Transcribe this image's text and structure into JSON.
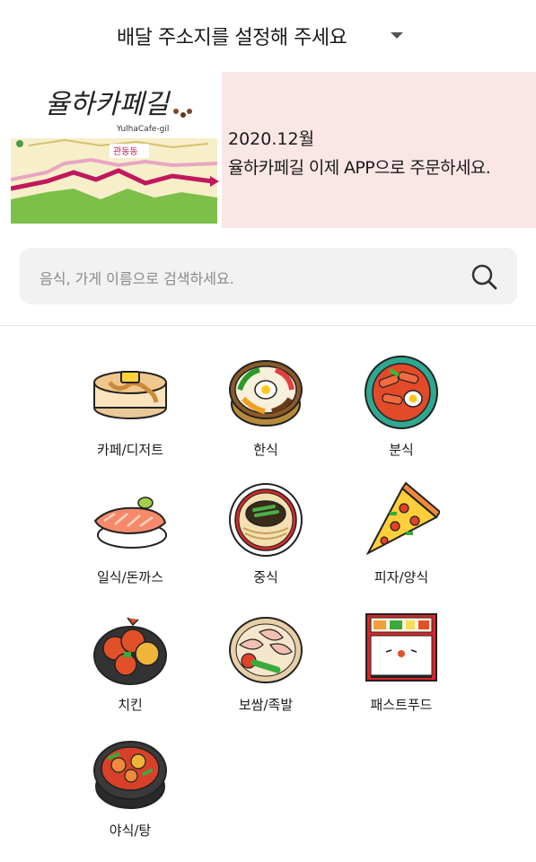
{
  "header": {
    "address_title": "배달 주소지를 설정해 주세요"
  },
  "banner": {
    "logo_text": "율하카페길",
    "logo_subtext": "YulhaCafe-gil",
    "map_label": "관동동",
    "line1": "2020.12월",
    "line2": "율하카페길 이제 APP으로 주문하세요."
  },
  "search": {
    "placeholder": "음식, 가게 이름으로 검색하세요."
  },
  "categories": [
    {
      "label": "카페/디저트",
      "icon": "pancake-icon"
    },
    {
      "label": "한식",
      "icon": "bibimbap-icon"
    },
    {
      "label": "분식",
      "icon": "tteokbokki-icon"
    },
    {
      "label": "일식/돈까스",
      "icon": "sushi-icon"
    },
    {
      "label": "중식",
      "icon": "jajangmyeon-icon"
    },
    {
      "label": "피자/양식",
      "icon": "pizza-icon"
    },
    {
      "label": "치킨",
      "icon": "chicken-icon"
    },
    {
      "label": "보쌈/족발",
      "icon": "bossam-icon"
    },
    {
      "label": "패스트푸드",
      "icon": "lunchbox-icon"
    },
    {
      "label": "야식/탕",
      "icon": "stew-icon"
    }
  ]
}
